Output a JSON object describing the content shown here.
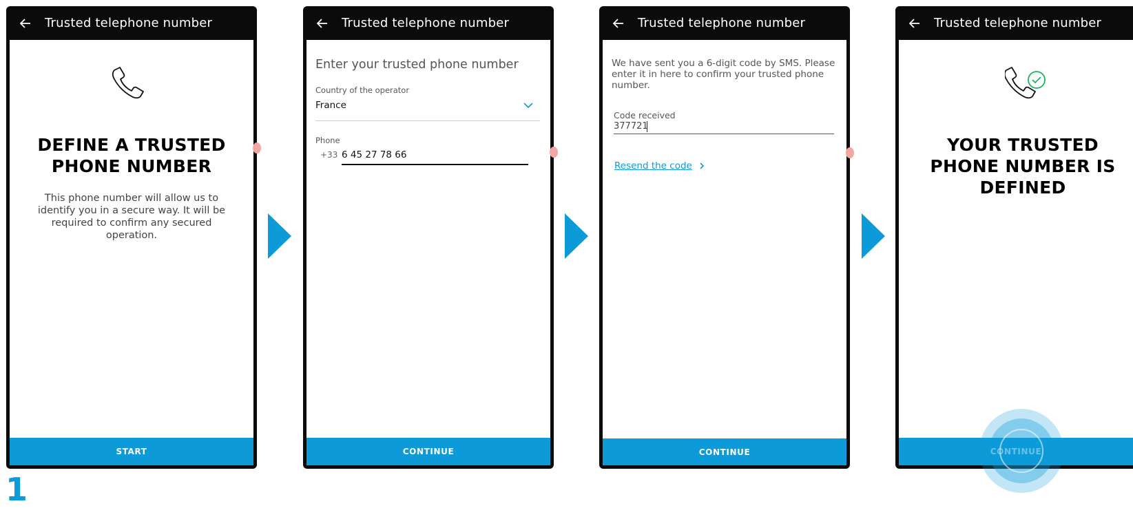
{
  "colors": {
    "brand_blue": "#0d9ad9",
    "frame": "#0b0b0b",
    "success_green": "#20b25a"
  },
  "step_number": "1",
  "screens": [
    {
      "title": "Trusted telephone number",
      "icon": "phone-icon",
      "heading_line1": "DEFINE A TRUSTED",
      "heading_line2": "PHONE NUMBER",
      "body": "This phone number will allow us to identify you in a secure way. It will be required to confirm any secured operation.",
      "button": "START"
    },
    {
      "title": "Trusted telephone number",
      "heading": "Enter your trusted phone number",
      "country_label": "Country of the operator",
      "country_value": "France",
      "phone_label": "Phone",
      "phone_prefix": "+33",
      "phone_value": "6 45 27 78 66",
      "button": "CONTINUE"
    },
    {
      "title": "Trusted telephone number",
      "message": "We have sent you a 6-digit code by SMS. Please enter it in here to confirm your trusted phone number.",
      "code_label": "Code received",
      "code_value": "377721",
      "resend_link": "Resend the code",
      "button": "CONTINUE"
    },
    {
      "title": "Trusted telephone number",
      "icon": "phone-check-icon",
      "heading_line1": "YOUR TRUSTED",
      "heading_line2": "PHONE NUMBER IS",
      "heading_line3": "DEFINED",
      "button": "CONTINUE"
    }
  ]
}
